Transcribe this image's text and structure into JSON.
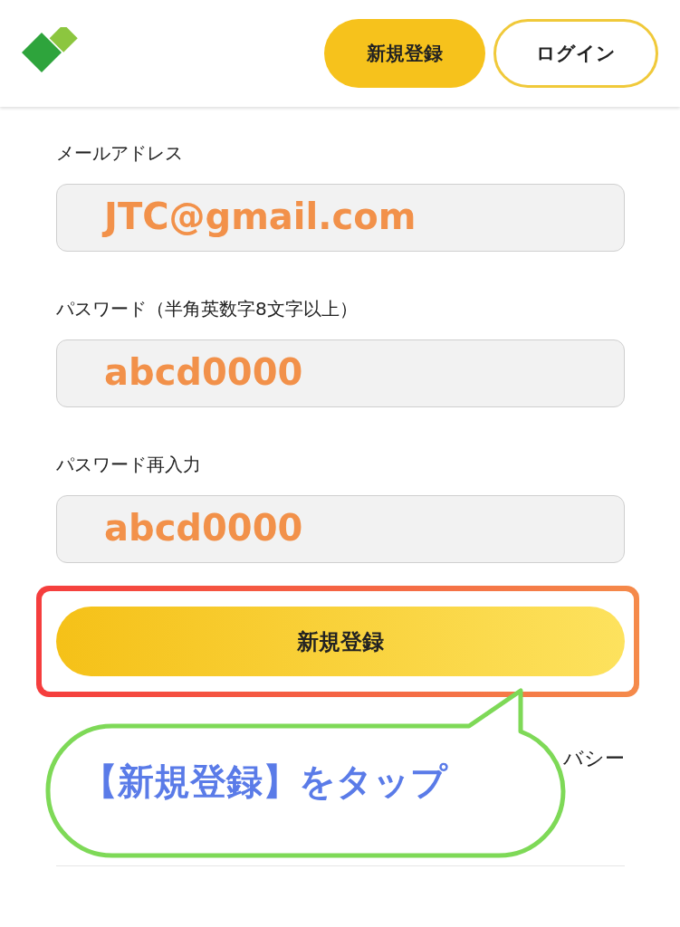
{
  "header": {
    "buttons": [
      {
        "label": "新規登録",
        "kind": "primary"
      },
      {
        "label": "ログイン",
        "kind": "outline"
      }
    ]
  },
  "fields": [
    {
      "label": "メールアドレス",
      "value": "JTC@gmail.com"
    },
    {
      "label": "パスワード（半角英数字8文字以上）",
      "value": "abcd0000"
    },
    {
      "label": "パスワード再入力",
      "value": "abcd0000"
    }
  ],
  "submit": {
    "label": "新規登録"
  },
  "terms": {
    "lines": [
      "バシー"
    ]
  },
  "callout": {
    "text": "【新規登録】をタップ"
  }
}
